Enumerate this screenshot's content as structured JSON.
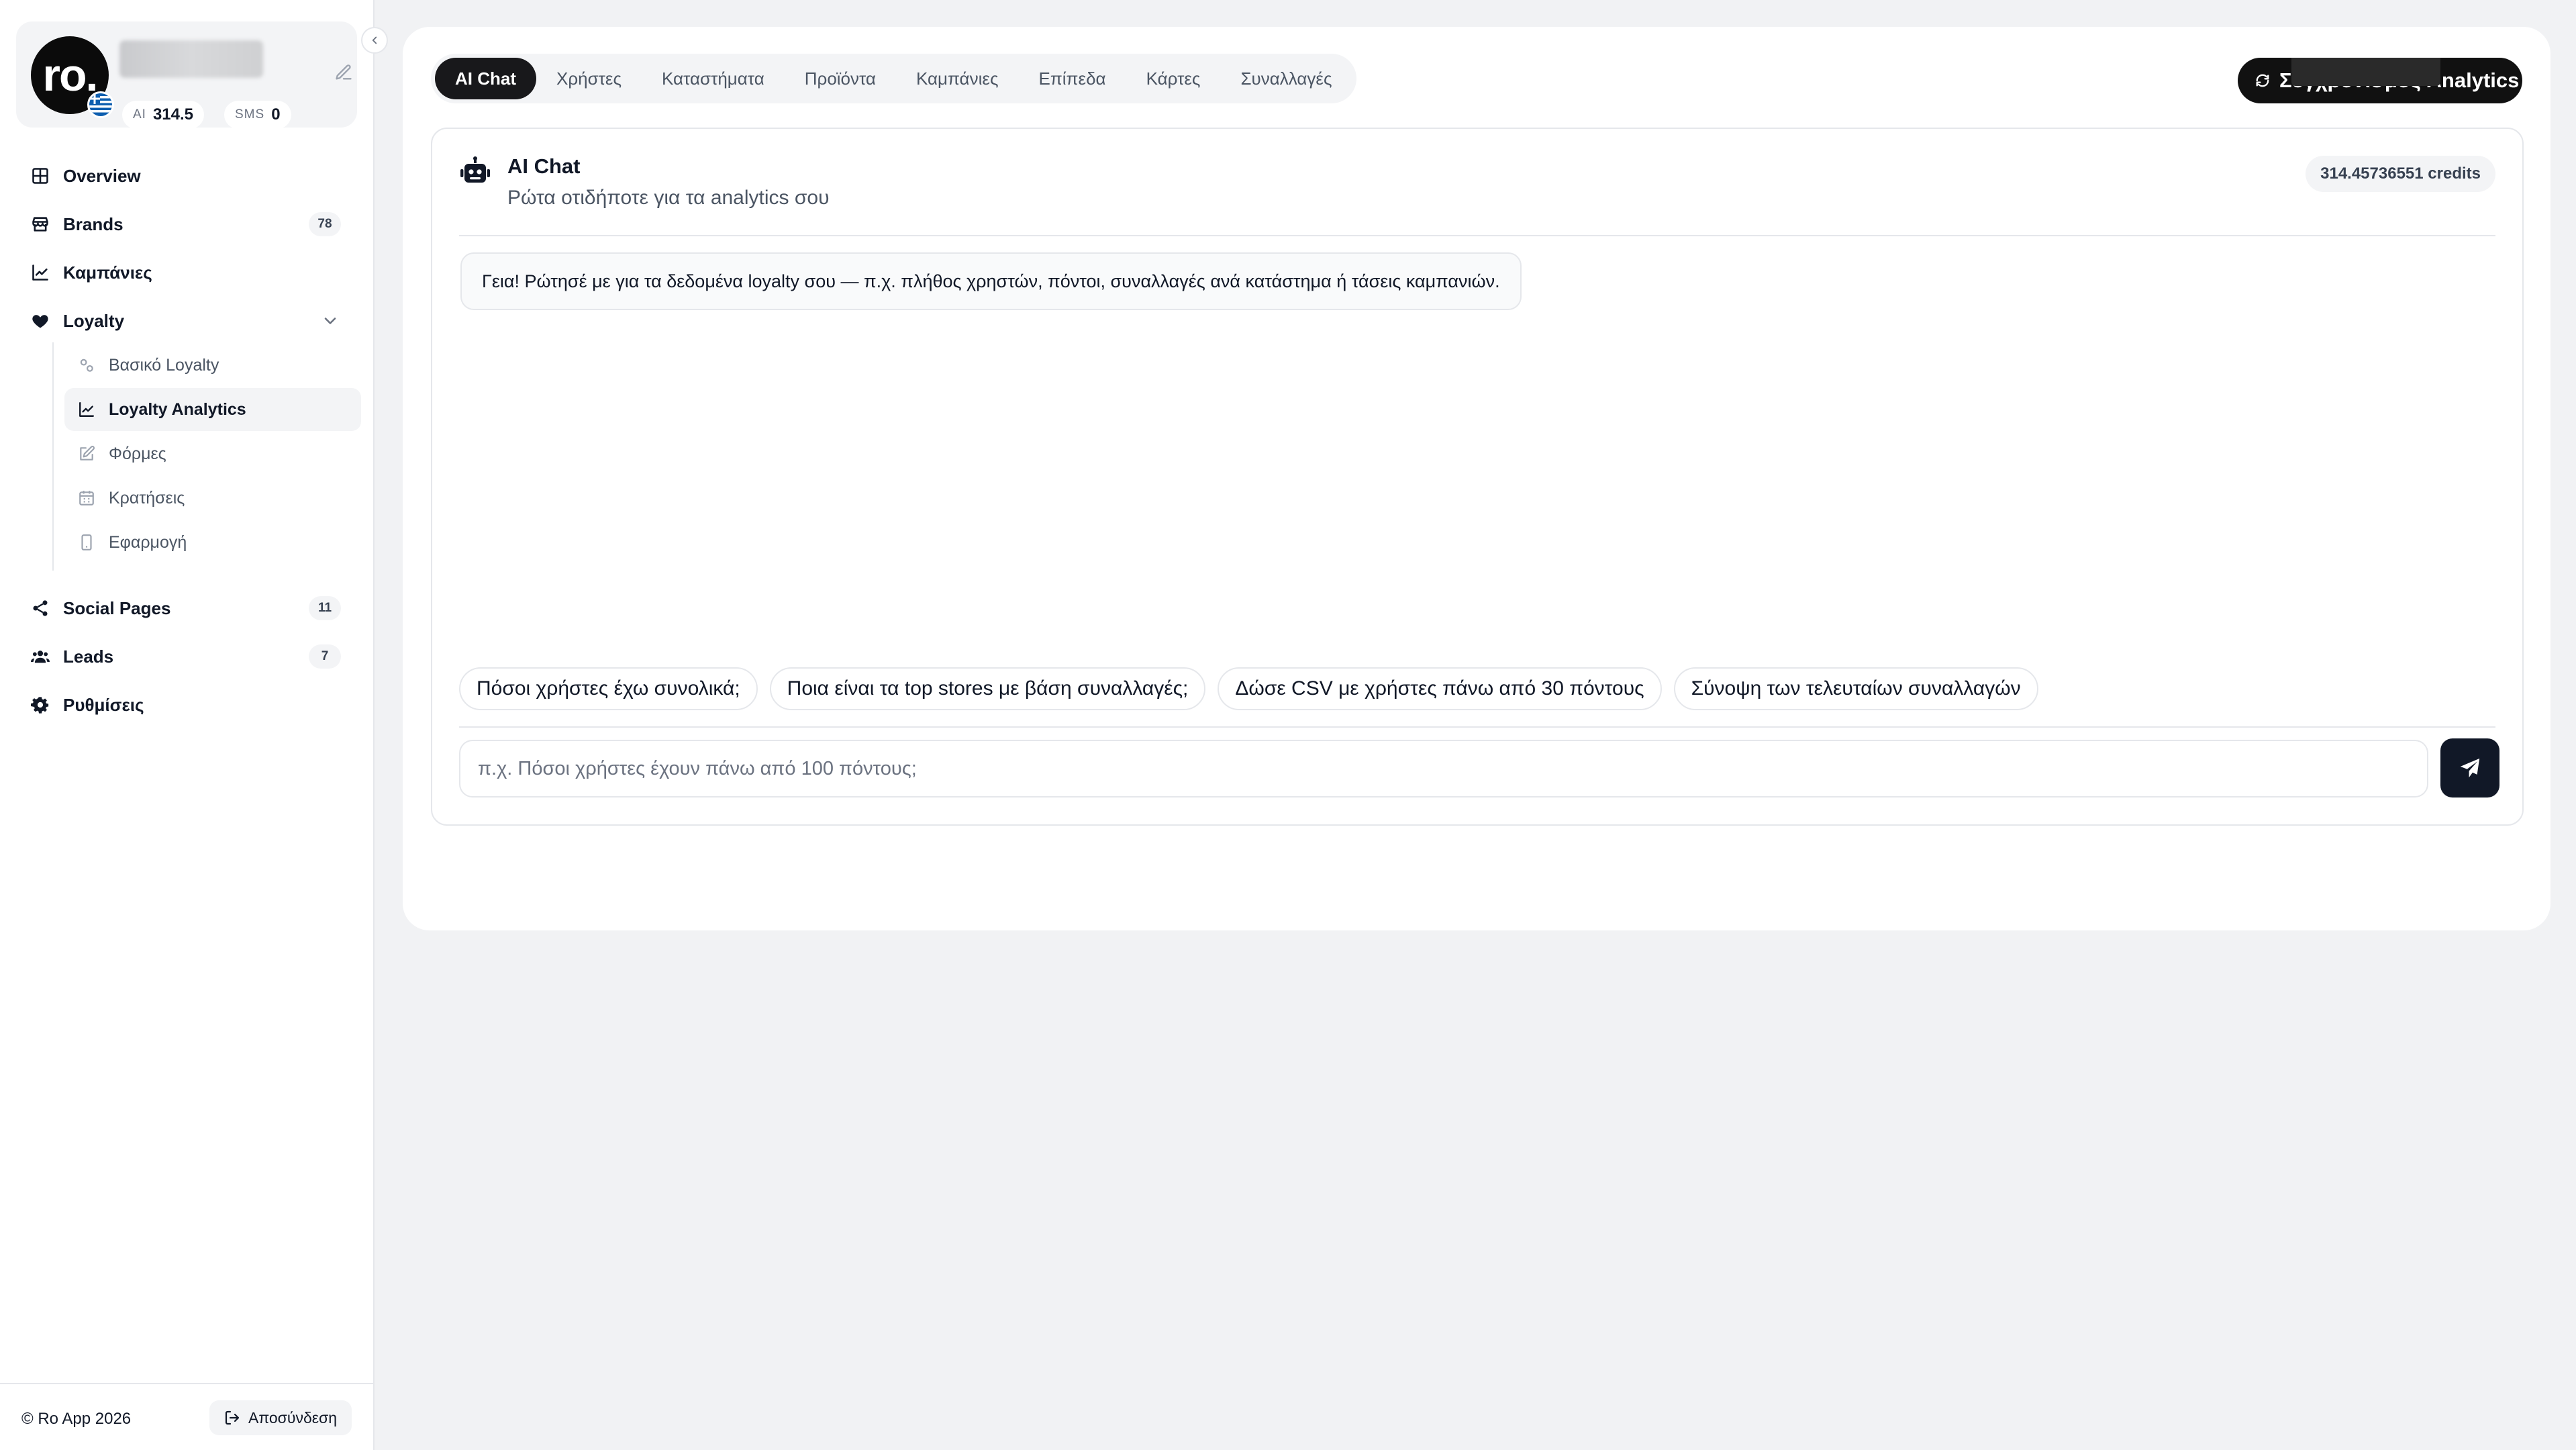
{
  "profile": {
    "logo_text": "ro",
    "logo_dot": ".",
    "ai_label": "AI",
    "ai_value": "314.5",
    "sms_label": "SMS",
    "sms_value": "0"
  },
  "nav": {
    "overview": "Overview",
    "brands": "Brands",
    "brands_count": "78",
    "campaigns": "Καμπάνιες",
    "loyalty": "Loyalty",
    "loyalty_sub": {
      "basic": "Βασικό Loyalty",
      "analytics": "Loyalty Analytics",
      "forms": "Φόρμες",
      "bookings": "Κρατήσεις",
      "app": "Εφαρμογή"
    },
    "social_pages": "Social Pages",
    "social_pages_count": "11",
    "leads": "Leads",
    "leads_count": "7",
    "settings": "Ρυθμίσεις"
  },
  "footer": {
    "copyright": "© Ro App  2026",
    "logout": "Αποσύνδεση"
  },
  "tabs": [
    "AI Chat",
    "Χρήστες",
    "Καταστήματα",
    "Προϊόντα",
    "Καμπάνιες",
    "Επίπεδα",
    "Κάρτες",
    "Συναλλαγές"
  ],
  "active_tab": "AI Chat",
  "sync_button": "Συγχρονισμός Analytics",
  "chat": {
    "title": "AI Chat",
    "subtitle": "Ρώτα οτιδήποτε για τα analytics σου",
    "credits": "314.45736551 credits",
    "assistant_message": "Γεια! Ρώτησέ με για τα δεδομένα loyalty σου — π.χ. πλήθος χρηστών, πόντοι, συναλλαγές ανά κατάστημα ή τάσεις καμπανιών.",
    "suggestions": [
      "Πόσοι χρήστες έχω συνολικά;",
      "Ποια είναι τα top stores με βάση συναλλαγές;",
      "Δώσε CSV με χρήστες πάνω από 30 πόντους",
      "Σύνοψη των τελευταίων συναλλαγών"
    ],
    "input_placeholder": "π.χ. Πόσοι χρήστες έχουν πάνω από 100 πόντους;",
    "input_value": ""
  },
  "colors": {
    "accent": "#111827",
    "page_bg": "#f1f2f4",
    "border": "#e5e7eb"
  }
}
